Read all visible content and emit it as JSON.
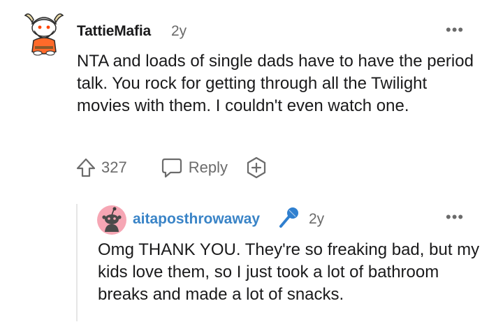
{
  "comment": {
    "username": "TattieMafia",
    "age": "2y",
    "more": "•••",
    "text": "NTA and loads of single dads have to have the period talk. You rock for getting through all the Twilight movies with them. I couldn't even watch one.",
    "score": "327",
    "reply_label": "Reply",
    "avatar_icon": "snoo-viking-avatar-icon"
  },
  "reply": {
    "username": "aitaposthrowaway",
    "age": "2y",
    "more": "•••",
    "text": "Omg THANK YOU. They're so freaking bad, but my kids love them, so I just took a lot of bathroom breaks and made a lot of snacks.",
    "flair_icon": "microphone-icon",
    "avatar_icon": "snoo-default-avatar-icon",
    "username_color": "#3a84c7"
  }
}
